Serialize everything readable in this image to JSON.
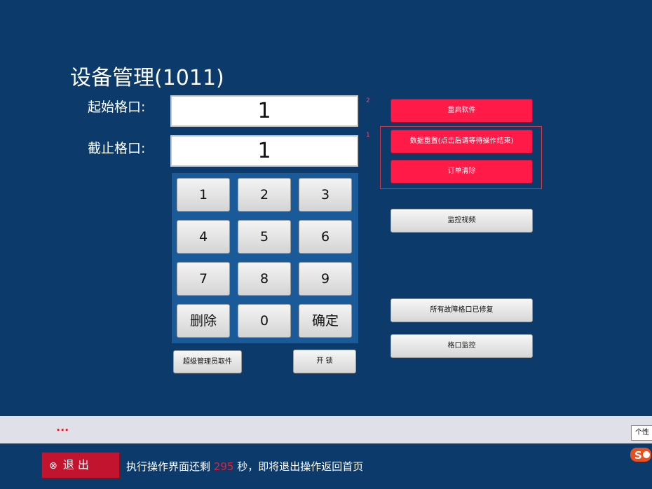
{
  "page": {
    "title": "设备管理(1011)"
  },
  "form": {
    "start_label": "起始格口:",
    "start_value": "1",
    "end_label": "截止格口:",
    "end_value": "1",
    "marker_top": "2",
    "marker_second": "1"
  },
  "keypad": {
    "keys": [
      "1",
      "2",
      "3",
      "4",
      "5",
      "6",
      "7",
      "8",
      "9",
      "删除",
      "0",
      "确定"
    ]
  },
  "below_keypad": {
    "admin_label": "超级管理员取件",
    "unlock_label": "开 锁"
  },
  "actions": {
    "restart_label": "重启软件",
    "reset_label": "数据重置(点击后请等待操作结束)",
    "clear_orders_label": "订单清除",
    "monitor_video_label": "监控视频",
    "fault_fixed_label": "所有故障格口已修复",
    "slot_monitor_label": "格口监控"
  },
  "message_bar": {
    "text": "..."
  },
  "footer": {
    "exit_label": "退 出",
    "countdown_prefix": "执行操作界面还剩",
    "countdown_value": "295",
    "countdown_suffix": "秒，即将退出操作返回首页"
  },
  "ime": {
    "tooltip_text": "个性"
  },
  "colors": {
    "background": "#0b3a6b",
    "keypad_panel": "#1a5a99",
    "danger": "#ff1a48",
    "exit": "#c2142e"
  }
}
